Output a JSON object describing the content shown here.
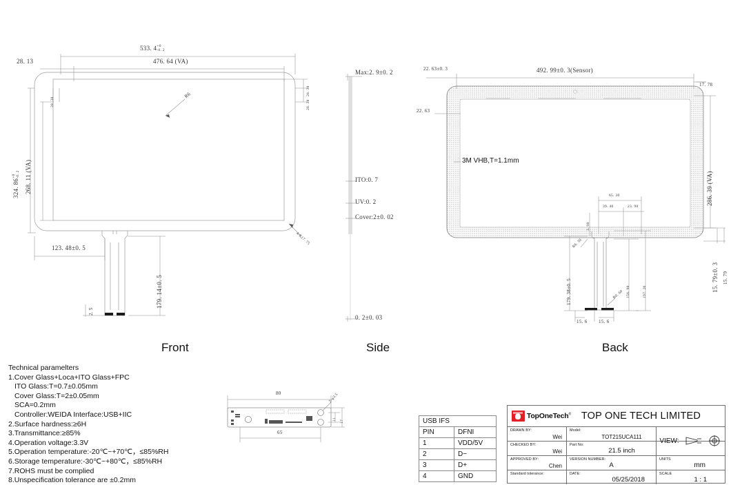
{
  "document": {
    "type": "mechanical-drawing",
    "views": [
      {
        "key": "front",
        "label": "Front"
      },
      {
        "key": "side",
        "label": "Side"
      },
      {
        "key": "back",
        "label": "Back"
      }
    ]
  },
  "front_view": {
    "label": "Front",
    "dimensions": {
      "overall_width": "533. 4",
      "overall_width_tol_upper": "+0",
      "overall_width_tol_lower": "-0. 2",
      "active_width": "476. 64 (VA)",
      "left_border": "28. 13",
      "overall_height": "324. 86",
      "overall_height_tol_upper": "+0",
      "overall_height_tol_lower": "-0. 2",
      "active_height": "268. 11 (VA)",
      "top_border": "28. 38",
      "top_border_2": "28. 38",
      "left_inner": "28. 38",
      "fpc_offset": "123. 48±0. 5",
      "fpc_length": "179. 14±0. 5",
      "fpc_width": "2. 5",
      "corner_radius": "4-R17. 75",
      "glass_radius": "R6"
    }
  },
  "side_view": {
    "label": "Side",
    "dimensions": {
      "total_thickness": "Max:2. 9±0. 2",
      "ito": "ITO:0. 7",
      "uv": "UV:0. 2",
      "cover": "Cover:2±0. 02",
      "fpc_thickness": "0. 2±0. 03"
    }
  },
  "back_view": {
    "label": "Back",
    "annotations": {
      "adhesive": "3M VHB,T=1.1mm"
    },
    "dimensions": {
      "left_margin_tol": "22. 63±0. 3",
      "sensor_width": "492. 99±0. 3(Sensor)",
      "right_top": "17. 78",
      "left_inner": "22. 63",
      "active_height": "286. 39 (VA)",
      "bottom_right_tol": "15. 79±0. 3",
      "bottom_right": "15. 79",
      "detail_a": "65. 30",
      "detail_b": "39. 40",
      "detail_c": "23. 90",
      "detail_d": "3. 98",
      "detail_r": "R6. 30",
      "fpc_length": "179. 38±0. 5",
      "fpc_inner": "156. 98",
      "fpc_outer": "197. 26",
      "fpc_left": "15. 6",
      "fpc_right": "15. 6",
      "fpc_radius": "R0. 60"
    }
  },
  "pcb_view": {
    "dimensions": {
      "width": "80",
      "hole_span": "65",
      "hole_height": "11",
      "board_height": "17",
      "holes": "2-φ3.5"
    }
  },
  "tech_params": {
    "title": "Technical paramelters",
    "lines": [
      {
        "text": "1.Cover Glass+Loca+ITO Glass+FPC",
        "indent": false
      },
      {
        "text": "ITO Glass:T=0.7±0.05mm",
        "indent": true
      },
      {
        "text": "Cover Glass:T=2±0.05mm",
        "indent": true
      },
      {
        "text": "SCA=0.2mm",
        "indent": true
      },
      {
        "text": "Controller:WEIDA    Interface:USB+IIC",
        "indent": true
      },
      {
        "text": "2.Surface hardness:≥6H",
        "indent": false
      },
      {
        "text": "3.Transmittance:≥85%",
        "indent": false
      },
      {
        "text": "4.Operation voltage:3.3V",
        "indent": false
      },
      {
        "text": "5.Operation temperature:-20℃~+70℃，≤85%RH",
        "indent": false
      },
      {
        "text": "6.Storage temperature:-30℃~+80℃，≤85%RH",
        "indent": false
      },
      {
        "text": "7.ROHS must be complied",
        "indent": false
      },
      {
        "text": "8.Unspecification tolerance are ±0.2mm",
        "indent": false
      }
    ]
  },
  "usb_table": {
    "title": "USB IFS",
    "columns": [
      "PIN",
      "DFNI"
    ],
    "rows": [
      {
        "pin": "1",
        "signal": "VDD/5V"
      },
      {
        "pin": "2",
        "signal": "D−"
      },
      {
        "pin": "3",
        "signal": "D+"
      },
      {
        "pin": "4",
        "signal": "GND"
      }
    ]
  },
  "title_block": {
    "logo_text": "TopOneTech",
    "logo_sup": "®",
    "company": "TOP ONE TECH LIMITED",
    "fields": {
      "drawn_by_label": "DRAWN BY:",
      "drawn_by_value": "Wei",
      "checked_by_label": "CHECKED BY:",
      "checked_by_value": "Wei",
      "approved_by_label": "APPROVED BY:",
      "approved_by_value": "Chen",
      "std_tolerance_label": "Standard tolerance:",
      "std_tolerance_value": "",
      "model_label": "Model:",
      "model_value": "TOT215UCA111",
      "part_no_label": "Part No:",
      "part_no_value": "21.5 inch",
      "version_label": "VERSION NUMBER:",
      "version_value": "A",
      "date_label": "DATE:",
      "date_value": "05/25/2018",
      "view_label": "VIEW:",
      "units_label": "UNITS",
      "units_value": "mm",
      "scale_label": "SCALE",
      "scale_value": "1 : 1"
    },
    "accent_color": "#e01f26"
  }
}
